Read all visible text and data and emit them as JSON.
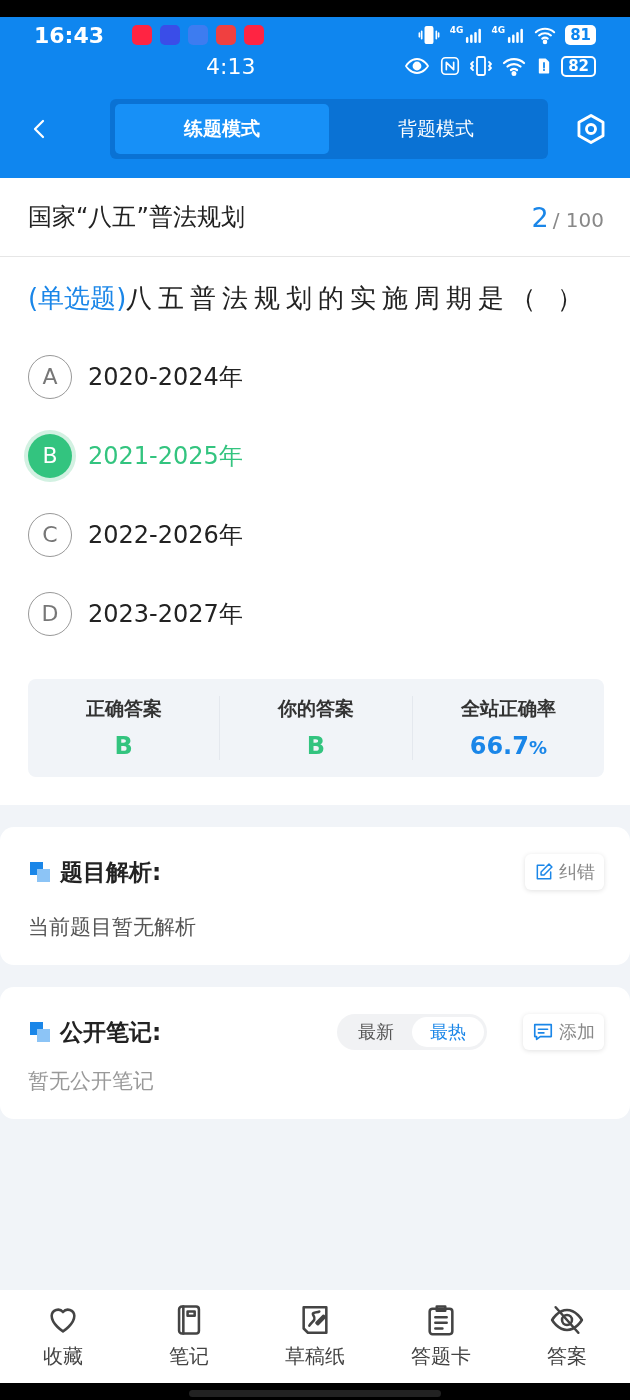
{
  "status_bar": {
    "time": "16:43",
    "app_icons": [
      {
        "color": "#ff2442"
      },
      {
        "color": "#3a4de8"
      },
      {
        "color": "#3d7cf0"
      },
      {
        "color": "#f04040"
      },
      {
        "color": "#ff2442"
      }
    ],
    "network_labels": [
      "4G",
      "4G"
    ],
    "battery": "81"
  },
  "recording_bar": {
    "time": "4:13",
    "battery": "82"
  },
  "nav": {
    "tabs": [
      {
        "label": "练题模式",
        "selected": true
      },
      {
        "label": "背题模式",
        "selected": false
      }
    ]
  },
  "chapter": {
    "title": "国家“八五”普法规划",
    "current": "2",
    "total": "/ 100"
  },
  "question": {
    "type": "(单选题)",
    "text": "八五普法规划的实施周期是（  ）"
  },
  "options": [
    {
      "letter": "A",
      "text": "2020-2024年",
      "selected": false
    },
    {
      "letter": "B",
      "text": "2021-2025年",
      "selected": true
    },
    {
      "letter": "C",
      "text": "2022-2026年",
      "selected": false
    },
    {
      "letter": "D",
      "text": "2023-2027年",
      "selected": false
    }
  ],
  "stats": [
    {
      "label": "正确答案",
      "value": "B",
      "kind": "answer"
    },
    {
      "label": "你的答案",
      "value": "B",
      "kind": "answer"
    },
    {
      "label": "全站正确率",
      "value": "66.7",
      "unit": "%",
      "kind": "rate"
    }
  ],
  "analysis": {
    "title": "题目解析:",
    "button": "纠错",
    "text": "当前题目暂无解析"
  },
  "notes": {
    "title": "公开笔记:",
    "sort_tabs": [
      {
        "label": "最新",
        "selected": false
      },
      {
        "label": "最热",
        "selected": true
      }
    ],
    "button": "添加",
    "text": "暂无公开笔记"
  },
  "bottom_nav": [
    {
      "label": "收藏",
      "kind": "heart"
    },
    {
      "label": "笔记",
      "kind": "notebook"
    },
    {
      "label": "草稿纸",
      "kind": "draft"
    },
    {
      "label": "答题卡",
      "kind": "clipboard"
    },
    {
      "label": "答案",
      "kind": "eye-off"
    }
  ]
}
